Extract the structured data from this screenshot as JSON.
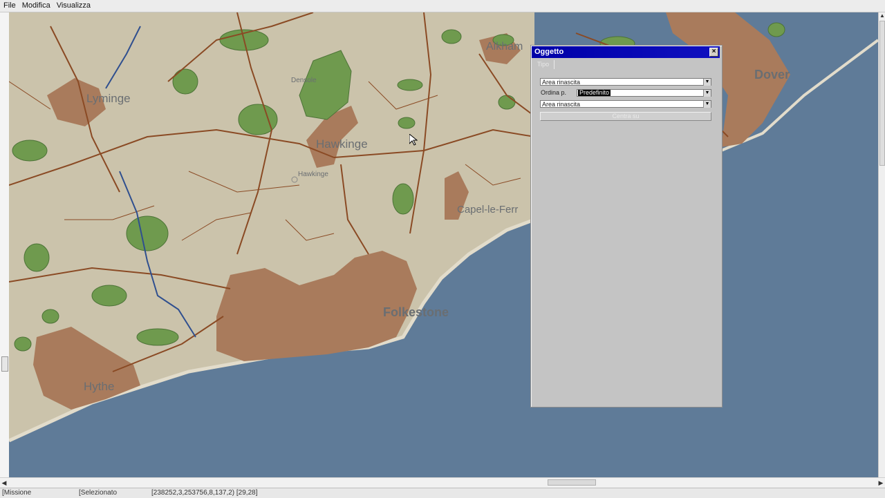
{
  "menu": {
    "items": [
      "File",
      "Modifica",
      "Visualizza"
    ]
  },
  "map": {
    "labels": {
      "dover": "Dover",
      "lyminge": "Lyminge",
      "hawkinge": "Hawkinge",
      "hawkinge_small": "Hawkinge",
      "densole": "Densole",
      "alkham": "Alkham",
      "capel": "Capel-le-Ferr",
      "folkestone": "Folkestone",
      "hythe": "Hythe"
    },
    "colors": {
      "land": "#cbc3ab",
      "sea": "#5f7b98",
      "urban": "#a97b5c",
      "road": "#8a4a24",
      "forest": "#6f9a4e",
      "river": "#2f4f8f"
    }
  },
  "dialog": {
    "title": "Oggetto",
    "tab_label": "Tipo",
    "type_value": "Area rinascita",
    "sort_label": "Ordina p.",
    "sort_value": "Predefinito",
    "item_value": "Area rinascita",
    "action_button": "Centra su",
    "close_symbol": "×"
  },
  "status": {
    "mode": "[Missione",
    "selection": "[Selezionato",
    "coords": "[238252,3,253756,8,137,2) [29,28]"
  },
  "icons": {
    "dropdown": "dropdown-arrow-icon",
    "close": "close-icon",
    "cursor": "pointer-cursor-icon"
  }
}
